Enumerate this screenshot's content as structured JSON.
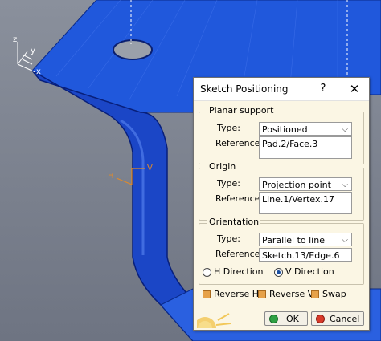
{
  "dialog": {
    "title": "Sketch Positioning",
    "help": "?",
    "close": "✕",
    "planar_support": {
      "legend": "Planar support",
      "type_label": "Type:",
      "type_value": "Positioned",
      "reference_label": "Reference:",
      "reference_value": "Pad.2/Face.3"
    },
    "origin": {
      "legend": "Origin",
      "type_label": "Type:",
      "type_value": "Projection point",
      "reference_label": "Reference:",
      "reference_value": "Line.1/Vertex.17"
    },
    "orientation": {
      "legend": "Orientation",
      "type_label": "Type:",
      "type_value": "Parallel to line",
      "reference_label": "Reference:",
      "reference_value": "Sketch.13/Edge.6",
      "h_direction": "H Direction",
      "v_direction": "V Direction",
      "selected_direction": "V Direction"
    },
    "options": {
      "reverse_h": "Reverse H",
      "reverse_v": "Reverse V",
      "swap": "Swap"
    },
    "ok": "OK",
    "cancel": "Cancel"
  },
  "viewport": {
    "compass_labels": {
      "z": "z",
      "y": "y",
      "x": "x"
    },
    "sketch_axes": {
      "h": "H",
      "v": "V"
    },
    "colors": {
      "background": "#7e8492",
      "part_blue": "#1f54d8",
      "part_dark": "#0c2fa0",
      "axis_orange": "#e08a2a"
    }
  }
}
